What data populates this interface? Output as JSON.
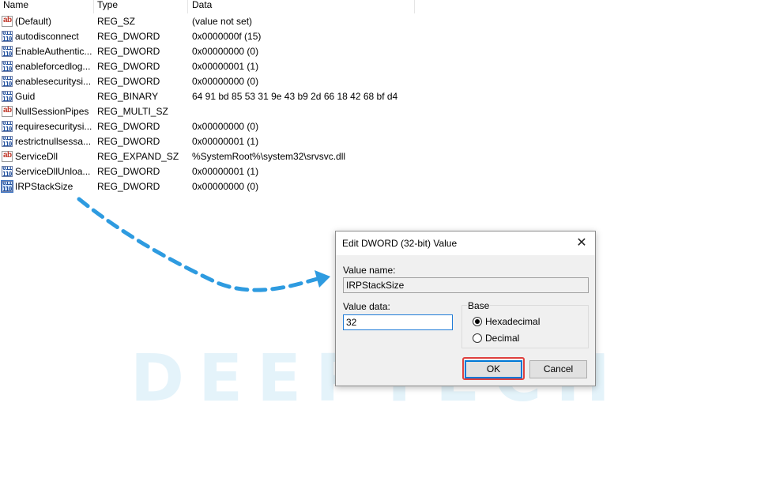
{
  "columns": {
    "name": "Name",
    "type": "Type",
    "data": "Data"
  },
  "rows": [
    {
      "icon": "string-value-icon",
      "name": "(Default)",
      "type": "REG_SZ",
      "data": "(value not set)"
    },
    {
      "icon": "binary-value-icon",
      "name": "autodisconnect",
      "type": "REG_DWORD",
      "data": "0x0000000f (15)"
    },
    {
      "icon": "binary-value-icon",
      "name": "EnableAuthentic...",
      "type": "REG_DWORD",
      "data": "0x00000000 (0)"
    },
    {
      "icon": "binary-value-icon",
      "name": "enableforcedlog...",
      "type": "REG_DWORD",
      "data": "0x00000001 (1)"
    },
    {
      "icon": "binary-value-icon",
      "name": "enablesecuritysi...",
      "type": "REG_DWORD",
      "data": "0x00000000 (0)"
    },
    {
      "icon": "binary-value-icon",
      "name": "Guid",
      "type": "REG_BINARY",
      "data": "64 91 bd 85 53 31 9e 43 b9 2d 66 18 42 68 bf d4"
    },
    {
      "icon": "string-value-icon",
      "name": "NullSessionPipes",
      "type": "REG_MULTI_SZ",
      "data": ""
    },
    {
      "icon": "binary-value-icon",
      "name": "requiresecuritysi...",
      "type": "REG_DWORD",
      "data": "0x00000000 (0)"
    },
    {
      "icon": "binary-value-icon",
      "name": "restrictnullsessa...",
      "type": "REG_DWORD",
      "data": "0x00000001 (1)"
    },
    {
      "icon": "string-value-icon",
      "name": "ServiceDll",
      "type": "REG_EXPAND_SZ",
      "data": "%SystemRoot%\\system32\\srvsvc.dll"
    },
    {
      "icon": "binary-value-icon",
      "name": "ServiceDllUnloa...",
      "type": "REG_DWORD",
      "data": "0x00000001 (1)"
    },
    {
      "icon": "binary-value-icon",
      "name": "IRPStackSize",
      "type": "REG_DWORD",
      "data": "0x00000000 (0)",
      "selected": true
    }
  ],
  "icon_glyphs": {
    "string": "ab",
    "binary": "011\n110"
  },
  "watermark": "DEEPTECH",
  "dialog": {
    "title": "Edit DWORD (32-bit) Value",
    "close_glyph": "✕",
    "value_name_label": "Value name:",
    "value_name": "IRPStackSize",
    "value_data_label": "Value data:",
    "value_data": "32",
    "base_label": "Base",
    "base_options": [
      "Hexadecimal",
      "Decimal"
    ],
    "base_selected": "Hexadecimal",
    "ok_label": "OK",
    "cancel_label": "Cancel"
  },
  "colors": {
    "arrow": "#2e9be0",
    "highlight": "#e0413f",
    "focus": "#0078d7"
  }
}
